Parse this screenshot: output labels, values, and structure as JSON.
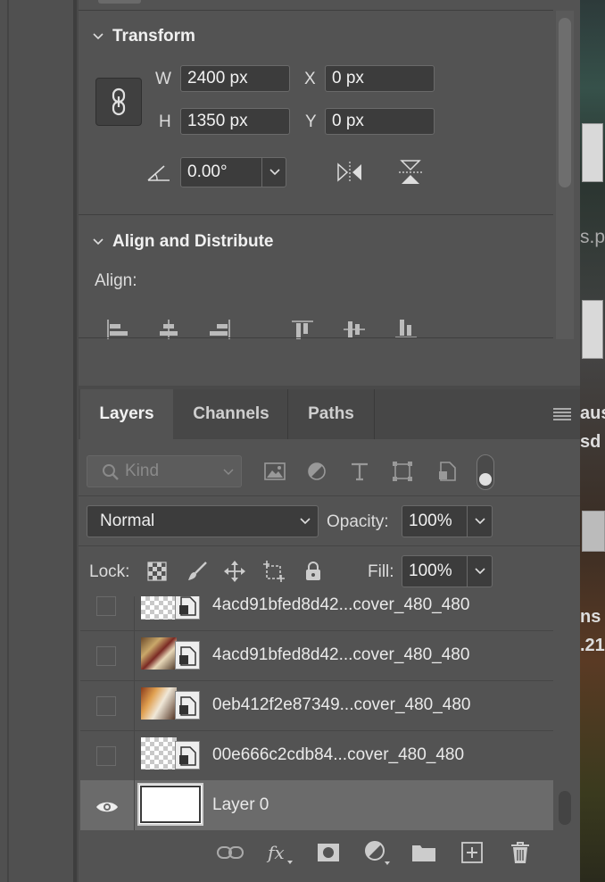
{
  "properties": {
    "transform": {
      "title": "Transform",
      "w_label": "W",
      "w_value": "2400 px",
      "h_label": "H",
      "h_value": "1350 px",
      "x_label": "X",
      "x_value": "0 px",
      "y_label": "Y",
      "y_value": "0 px",
      "angle_value": "0.00°"
    },
    "align": {
      "title": "Align and Distribute",
      "align_label": "Align:"
    }
  },
  "layers_panel": {
    "tabs": [
      {
        "label": "Layers",
        "active": true
      },
      {
        "label": "Channels",
        "active": false
      },
      {
        "label": "Paths",
        "active": false
      }
    ],
    "filter": {
      "placeholder": "Kind"
    },
    "blend_mode": "Normal",
    "opacity_label": "Opacity:",
    "opacity_value": "100%",
    "lock_label": "Lock:",
    "fill_label": "Fill:",
    "fill_value": "100%",
    "layers": [
      {
        "name": "4acd91bfed8d42...cover_480_480",
        "visible": false,
        "thumb": "transparent"
      },
      {
        "name": "4acd91bfed8d42...cover_480_480",
        "visible": false,
        "thumb": "photo"
      },
      {
        "name": "0eb412f2e87349...cover_480_480",
        "visible": false,
        "thumb": "photo2"
      },
      {
        "name": "00e666c2cdb84...cover_480_480",
        "visible": false,
        "thumb": "transparent"
      },
      {
        "name": "Layer 0",
        "visible": true,
        "selected": true,
        "thumb": "white"
      }
    ]
  },
  "background_fragments": {
    "text1": "s.p",
    "text2": "aus",
    "text3": "sd",
    "text4": "ns",
    "text5": ".21"
  },
  "colors": {
    "panel_bg": "#535353",
    "field_bg": "#3c3c3c",
    "selected_row": "#6b6b6b"
  }
}
